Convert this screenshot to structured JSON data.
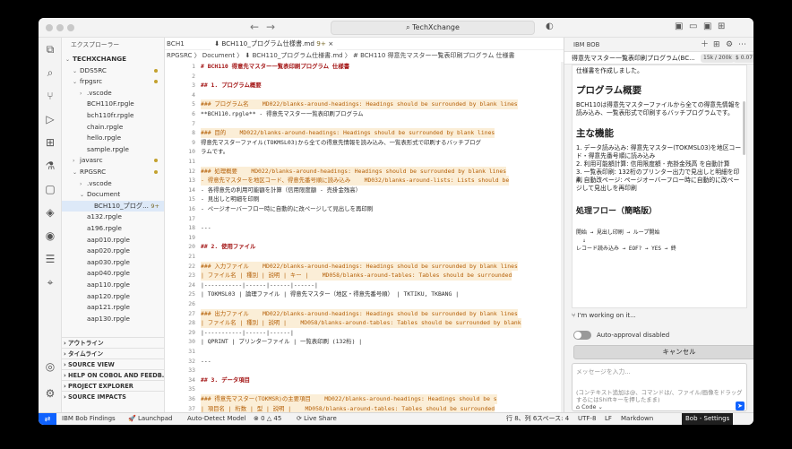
{
  "titlebar": {
    "search": "TechXchange"
  },
  "sidebar": {
    "title": "エクスプローラー",
    "items": [
      {
        "label": "TECHXCHANGE",
        "indent": 0,
        "chev": "⌄",
        "bold": true
      },
      {
        "label": "DDS5RC",
        "indent": 1,
        "chev": "⌄"
      },
      {
        "label": "frpgsrc",
        "indent": 1,
        "chev": "⌄"
      },
      {
        "label": ".vscode",
        "indent": 2,
        "chev": "›"
      },
      {
        "label": "BCH110F.rpgle",
        "indent": 2,
        "chev": ""
      },
      {
        "label": "bch110fr.rpgle",
        "indent": 2,
        "chev": ""
      },
      {
        "label": "chain.rpgle",
        "indent": 2,
        "chev": ""
      },
      {
        "label": "hello.rpgle",
        "indent": 2,
        "chev": ""
      },
      {
        "label": "sample.rpgle",
        "indent": 2,
        "chev": ""
      },
      {
        "label": "javasrc",
        "indent": 1,
        "chev": "›"
      },
      {
        "label": "RPGSRC",
        "indent": 1,
        "chev": "⌄"
      },
      {
        "label": ".vscode",
        "indent": 2,
        "chev": "›"
      },
      {
        "label": "Document",
        "indent": 2,
        "chev": "⌄"
      },
      {
        "label": "BCH110_プログ...",
        "indent": 3,
        "chev": "",
        "selected": true,
        "badge": "9+"
      },
      {
        "label": "a132.rpgle",
        "indent": 2,
        "chev": ""
      },
      {
        "label": "a196.rpgle",
        "indent": 2,
        "chev": ""
      },
      {
        "label": "aap010.rpgle",
        "indent": 2,
        "chev": ""
      },
      {
        "label": "aap020.rpgle",
        "indent": 2,
        "chev": ""
      },
      {
        "label": "aap030.rpgle",
        "indent": 2,
        "chev": ""
      },
      {
        "label": "aap040.rpgle",
        "indent": 2,
        "chev": ""
      },
      {
        "label": "aap110.rpgle",
        "indent": 2,
        "chev": ""
      },
      {
        "label": "aap120.rpgle",
        "indent": 2,
        "chev": ""
      },
      {
        "label": "aap121.rpgle",
        "indent": 2,
        "chev": ""
      },
      {
        "label": "aap130.rpgle",
        "indent": 2,
        "chev": ""
      }
    ],
    "panels": [
      "アウトライン",
      "タイムライン",
      "SOURCE VIEW",
      "HELP ON COBOL AND FEEDB...",
      "PROJECT EXPLORER",
      "SOURCE IMPACTS"
    ]
  },
  "editor": {
    "breadcrumb_left": "BCH1",
    "tab_label": "BCH110_プログラム仕様書.md",
    "tab_badge": "9+",
    "breadcrumbs": "RPGSRC 〉 Document 〉 ⬇ BCH110_プログラム仕様書.md 〉 # BCH110 得意先マスター一覧表印刷プログラム 仕様書",
    "lines": [
      {
        "n": "1",
        "t": "# BCH110 得意先マスター一覧表印刷プログラム 仕様書",
        "cls": "red bold"
      },
      {
        "n": "2",
        "t": "",
        "cls": ""
      },
      {
        "n": "3",
        "t": "## 1. プログラム概要",
        "cls": "red bold"
      },
      {
        "n": "4",
        "t": "",
        "cls": ""
      },
      {
        "n": "5",
        "t": "### プログラム名    MD022/blanks-around-headings: Headings should be surrounded by blank lines",
        "cls": "warn hl"
      },
      {
        "n": "6",
        "t": "**BCH110.rpgle** - 得意先マスター一覧表印刷プログラム",
        "cls": ""
      },
      {
        "n": "7",
        "t": "",
        "cls": ""
      },
      {
        "n": "8",
        "t": "### 目的    MD022/blanks-around-headings: Headings should be surrounded by blank lines",
        "cls": "warn hl"
      },
      {
        "n": "9",
        "t": "得意先マスターファイル(TOKMSL03)から全ての得意先情報を読み込み、一覧表形式で印刷するバッチプログ",
        "cls": ""
      },
      {
        "n": "10",
        "t": "ラムです。",
        "cls": ""
      },
      {
        "n": "11",
        "t": "",
        "cls": ""
      },
      {
        "n": "12",
        "t": "### 処理概要    MD022/blanks-around-headings: Headings should be surrounded by blank lines",
        "cls": "warn hl"
      },
      {
        "n": "13",
        "t": "- 得意先マスターを地区コード、得意先番号順に読み込み    MD032/blanks-around-lists: Lists should be",
        "cls": "warn hl"
      },
      {
        "n": "14",
        "t": "- 各得意先の利用可能額を計算（信用限度額 - 売掛金残高）",
        "cls": ""
      },
      {
        "n": "15",
        "t": "- 見出しと明細を印刷",
        "cls": ""
      },
      {
        "n": "16",
        "t": "- ページオーバーフロー時に自動的に改ページして見出しを再印刷",
        "cls": ""
      },
      {
        "n": "17",
        "t": "",
        "cls": ""
      },
      {
        "n": "18",
        "t": "---",
        "cls": ""
      },
      {
        "n": "19",
        "t": "",
        "cls": ""
      },
      {
        "n": "20",
        "t": "## 2. 使用ファイル",
        "cls": "red bold"
      },
      {
        "n": "21",
        "t": "",
        "cls": ""
      },
      {
        "n": "22",
        "t": "### 入力ファイル    MD022/blanks-around-headings: Headings should be surrounded by blank lines",
        "cls": "warn hl"
      },
      {
        "n": "23",
        "t": "| ファイル名 | 種別 | 説明 | キー |    MD058/blanks-around-tables: Tables should be surrounded",
        "cls": "warn hl"
      },
      {
        "n": "24",
        "t": "|-----------|------|------|------|",
        "cls": ""
      },
      {
        "n": "25",
        "t": "| TOKMSL03 | 論理ファイル | 得意先マスター（地区・得意先番号順） | TKTIKU, TKBANG |",
        "cls": ""
      },
      {
        "n": "26",
        "t": "",
        "cls": ""
      },
      {
        "n": "27",
        "t": "### 出力ファイル    MD022/blanks-around-headings: Headings should be surrounded by blank lines",
        "cls": "warn hl"
      },
      {
        "n": "28",
        "t": "| ファイル名 | 種別 | 説明 |    MD058/blanks-around-tables: Tables should be surrounded by blank",
        "cls": "warn hl"
      },
      {
        "n": "29",
        "t": "|-----------|------|------|",
        "cls": ""
      },
      {
        "n": "30",
        "t": "| QPRINT | プリンターファイル | 一覧表印刷 (132桁) |",
        "cls": ""
      },
      {
        "n": "31",
        "t": "",
        "cls": ""
      },
      {
        "n": "32",
        "t": "---",
        "cls": ""
      },
      {
        "n": "33",
        "t": "",
        "cls": ""
      },
      {
        "n": "34",
        "t": "## 3. データ項目",
        "cls": "red bold"
      },
      {
        "n": "35",
        "t": "",
        "cls": ""
      },
      {
        "n": "36",
        "t": "### 得意先マスター(TOKMSR)の主要項目    MD022/blanks-around-headings: Headings should be s",
        "cls": "warn hl"
      },
      {
        "n": "37",
        "t": "| 項目名 | 桁数 | 型 | 説明 |    MD058/blanks-around-tables: Tables should be surrounded",
        "cls": "warn hl"
      }
    ]
  },
  "chat": {
    "header": "IBM BOB",
    "session_title": "得意先マスター一覧表印刷プログラム(BC...",
    "tokens": "15k / 200k",
    "cost": "$ 0.07",
    "content": {
      "intro": "仕様書を作成しました。",
      "h_overview": "プログラム概要",
      "overview": "BCH110は得意先マスターファイルから全ての得意先情報を読み込み、一覧表形式で印刷するバッチプログラムです。",
      "h_features": "主な機能",
      "features": [
        "1. データ読み込み: 得意先マスター(TOKMSL03)を地区コード・得意先番号順に読み込み",
        "2. 利用可能額計算: 信用限度額 - 売掛金残高 を自動計算",
        "3. 一覧表印刷: 132桁のプリンター出力で見出しと明細を印刷",
        "4. 自動改ページ: ページオーバーフロー時に自動的に改ページして見出しを再印刷"
      ],
      "h_flow": "処理フロー（簡略版）",
      "flow1": "開始 → 見出し印刷 → ループ開始",
      "flow2": "  ↓",
      "flow3": "レコード読み込み → EOF? → YES → 終"
    },
    "working": "I'm working on it...",
    "auto_approval": "Auto-approval disabled",
    "cancel": "キャンセル",
    "input_placeholder": "メッセージを入力...",
    "input_hint": "(コンテキスト追加は@、コマンドは/、ファイル/画像をドラッグするにはShiftキーを押したまま)",
    "mode": "Code"
  },
  "statusbar": {
    "ibm_bob": "IBM Bob Findings",
    "launchpad": "Launchpad",
    "auto_detect": "Auto-Detect Model",
    "problems": "⊗ 0 △ 45",
    "live_share": "Live Share",
    "position": "行 8、列 6",
    "spaces": "スペース: 4",
    "encoding": "UTF-8",
    "eol": "LF",
    "language": "Markdown",
    "bob_settings": "Bob - Settings"
  }
}
